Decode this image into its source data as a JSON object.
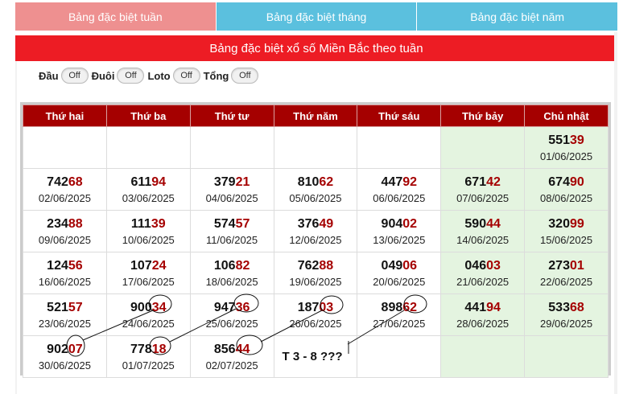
{
  "tabs": [
    {
      "label": "Bảng đặc biệt tuần",
      "active": true
    },
    {
      "label": "Bảng đặc biệt tháng",
      "active": false
    },
    {
      "label": "Bảng đặc biệt năm",
      "active": false
    }
  ],
  "banner": {
    "title": "Bảng đặc biệt xổ số Miền Bắc theo tuần"
  },
  "filters": [
    {
      "label": "Đầu",
      "state": "Off"
    },
    {
      "label": "Đuôi",
      "state": "Off"
    },
    {
      "label": "Loto",
      "state": "Off"
    },
    {
      "label": "Tổng",
      "state": "Off"
    }
  ],
  "table": {
    "headers": [
      "Thứ hai",
      "Thứ ba",
      "Thứ tư",
      "Thứ năm",
      "Thứ sáu",
      "Thứ bảy",
      "Chủ nhật"
    ],
    "rows": [
      [
        null,
        null,
        null,
        null,
        null,
        null,
        {
          "head": "551",
          "tail": "39",
          "date": "01/06/2025"
        }
      ],
      [
        {
          "head": "742",
          "tail": "68",
          "date": "02/06/2025"
        },
        {
          "head": "611",
          "tail": "94",
          "date": "03/06/2025"
        },
        {
          "head": "379",
          "tail": "21",
          "date": "04/06/2025"
        },
        {
          "head": "810",
          "tail": "62",
          "date": "05/06/2025"
        },
        {
          "head": "447",
          "tail": "92",
          "date": "06/06/2025"
        },
        {
          "head": "671",
          "tail": "42",
          "date": "07/06/2025"
        },
        {
          "head": "674",
          "tail": "90",
          "date": "08/06/2025"
        }
      ],
      [
        {
          "head": "234",
          "tail": "88",
          "date": "09/06/2025"
        },
        {
          "head": "111",
          "tail": "39",
          "date": "10/06/2025"
        },
        {
          "head": "574",
          "tail": "57",
          "date": "11/06/2025"
        },
        {
          "head": "376",
          "tail": "49",
          "date": "12/06/2025"
        },
        {
          "head": "904",
          "tail": "02",
          "date": "13/06/2025"
        },
        {
          "head": "590",
          "tail": "44",
          "date": "14/06/2025"
        },
        {
          "head": "320",
          "tail": "99",
          "date": "15/06/2025"
        }
      ],
      [
        {
          "head": "124",
          "tail": "56",
          "date": "16/06/2025"
        },
        {
          "head": "107",
          "tail": "24",
          "date": "17/06/2025"
        },
        {
          "head": "106",
          "tail": "82",
          "date": "18/06/2025"
        },
        {
          "head": "762",
          "tail": "88",
          "date": "19/06/2025"
        },
        {
          "head": "049",
          "tail": "06",
          "date": "20/06/2025"
        },
        {
          "head": "046",
          "tail": "03",
          "date": "21/06/2025"
        },
        {
          "head": "273",
          "tail": "01",
          "date": "22/06/2025"
        }
      ],
      [
        {
          "head": "521",
          "tail": "57",
          "date": "23/06/2025"
        },
        {
          "head": "900",
          "tail": "34",
          "date": "24/06/2025"
        },
        {
          "head": "947",
          "tail": "36",
          "date": "25/06/2025"
        },
        {
          "head": "187",
          "tail": "03",
          "date": "26/06/2025"
        },
        {
          "head": "898",
          "tail": "62",
          "date": "27/06/2025"
        },
        {
          "head": "441",
          "tail": "94",
          "date": "28/06/2025"
        },
        {
          "head": "533",
          "tail": "68",
          "date": "29/06/2025"
        }
      ],
      [
        {
          "head": "902",
          "tail": "07",
          "date": "30/06/2025"
        },
        {
          "head": "778",
          "tail": "18",
          "date": "01/07/2025"
        },
        {
          "head": "856",
          "tail": "44",
          "date": "02/07/2025"
        },
        {
          "note": "T 3 - 8 ???"
        },
        null,
        null,
        null
      ]
    ]
  },
  "colors": {
    "accent_red": "#ed1c24",
    "header_red": "#a50000",
    "tab_blue": "#5bc0de",
    "tab_active": "#ee9090",
    "weekend_green": "#e4f4e0"
  }
}
